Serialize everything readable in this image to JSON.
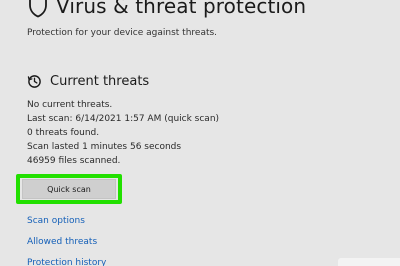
{
  "header": {
    "title": "Virus & threat protection",
    "subtitle": "Protection for your device against threats."
  },
  "current_threats": {
    "title": "Current threats",
    "lines": [
      "No current threats.",
      "Last scan: 6/14/2021 1:57 AM (quick scan)",
      "0 threats found.",
      "Scan lasted 1 minutes 56 seconds",
      "46959 files scanned."
    ],
    "quick_scan_label": "Quick scan",
    "highlight_color": "#22e000"
  },
  "links": {
    "scan_options": "Scan options",
    "allowed_threats": "Allowed threats",
    "protection_history": "Protection history"
  },
  "colors": {
    "background": "#e6e6e6",
    "link": "#1560b8",
    "button": "#cfcfcf"
  },
  "icons": {
    "header": "shield-icon",
    "section": "history-clock-icon"
  }
}
